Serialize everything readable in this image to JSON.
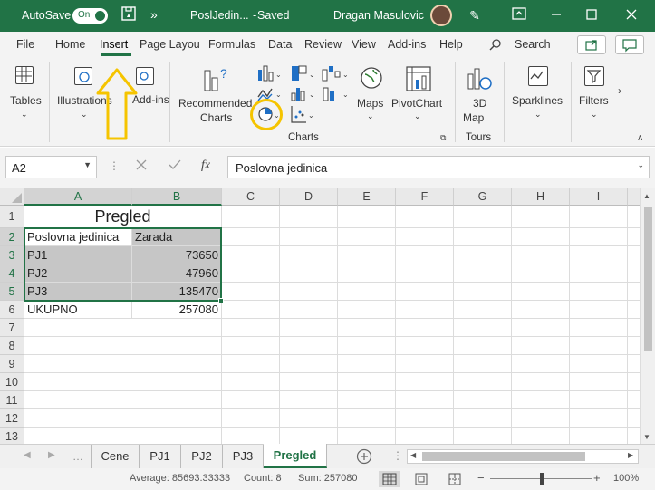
{
  "titlebar": {
    "autosave_label": "AutoSave",
    "toggle_label": "On",
    "filename": "PoslJedin...",
    "saved_status": "Saved",
    "user": "Dragan Masulovic",
    "more": "»",
    "bg_color": "#217346"
  },
  "tabs": [
    "File",
    "Home",
    "Insert",
    "Page Layou",
    "Formulas",
    "Data",
    "Review",
    "View",
    "Add-ins",
    "Help"
  ],
  "active_tab": "Insert",
  "search_label": "Search",
  "ribbon": {
    "tables": "Tables",
    "illustrations": "Illustrations",
    "addins": "Add-ins",
    "recommended_charts_1": "Recommended",
    "recommended_charts_2": "Charts",
    "maps": "Maps",
    "pivotchart": "PivotChart",
    "map3d_1": "3D",
    "map3d_2": "Map",
    "sparklines": "Sparklines",
    "filters": "Filters",
    "group_charts": "Charts",
    "group_tours": "Tours",
    "highlight_color": "#f5c400"
  },
  "formula_bar": {
    "name_box": "A2",
    "fx": "fx",
    "content": "Poslovna jedinica"
  },
  "columns": [
    "A",
    "B",
    "C",
    "D",
    "E",
    "F",
    "G",
    "H",
    "I"
  ],
  "rows": [
    "1",
    "2",
    "3",
    "4",
    "5",
    "6",
    "7",
    "8",
    "9",
    "10",
    "11",
    "12",
    "13"
  ],
  "cells": {
    "title": "Pregled",
    "header_a": "Poslovna jedinica",
    "header_b": "Zarada",
    "r3a": "PJ1",
    "r3b": "73650",
    "r4a": "PJ2",
    "r4b": "47960",
    "r5a": "PJ3",
    "r5b": "135470",
    "r6a": "UKUPNO",
    "r6b": "257080"
  },
  "sheet_tabs": [
    "Cene",
    "PJ1",
    "PJ2",
    "PJ3",
    "Pregled"
  ],
  "active_sheet": "Pregled",
  "status": {
    "average": "Average: 85693.33333",
    "count": "Count: 8",
    "sum": "Sum: 257080",
    "zoom": "100%"
  }
}
